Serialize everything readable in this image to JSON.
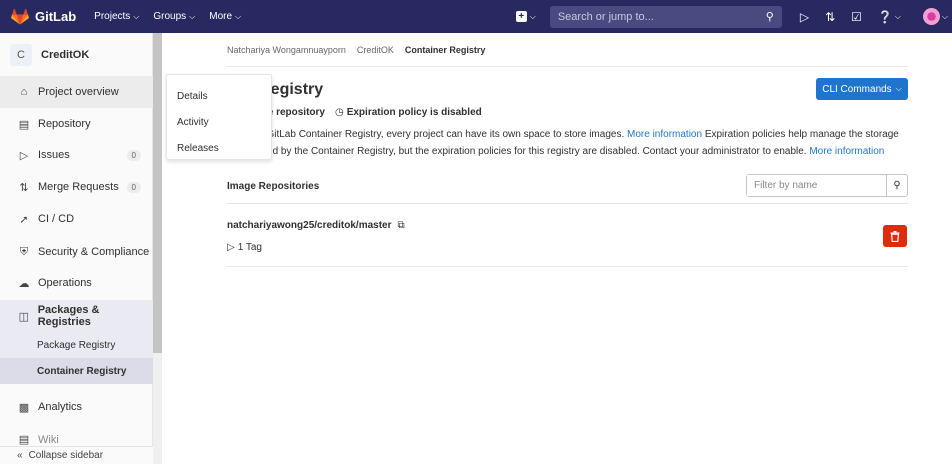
{
  "topbar": {
    "brand": "GitLab",
    "menus": [
      "Projects",
      "Groups",
      "More"
    ],
    "search_placeholder": "Search or jump to..."
  },
  "sidebar": {
    "project_initial": "C",
    "project_name": "CreditOK",
    "items": [
      {
        "label": "Project overview"
      },
      {
        "label": "Repository"
      },
      {
        "label": "Issues",
        "badge": "0"
      },
      {
        "label": "Merge Requests",
        "badge": "0"
      },
      {
        "label": "CI / CD"
      },
      {
        "label": "Security & Compliance"
      },
      {
        "label": "Operations"
      },
      {
        "label": "Packages & Registries"
      },
      {
        "label": "Analytics"
      },
      {
        "label": "Wiki"
      }
    ],
    "sub_items": [
      "Package Registry",
      "Container Registry"
    ],
    "collapse_label": "Collapse sidebar"
  },
  "flyout": {
    "items": [
      "Details",
      "Activity",
      "Releases"
    ]
  },
  "breadcrumb": [
    "Natchariya Wongamnuayporn",
    "CreditOK",
    "Container Registry"
  ],
  "main": {
    "title": "Container Registry",
    "cli_button": "CLI Commands",
    "repo_count": "1 Image repository",
    "expiration": "Expiration policy is disabled",
    "desc_1": "With the GitLab Container Registry, every project can have its own space to store images.",
    "link_more_1": "More information",
    "desc_2": "Expiration policies help manage the storage space used by the Container Registry, but the expiration policies for this registry are disabled. Contact your administrator to enable.",
    "link_more_2": "More information",
    "section_title": "Image Repositories",
    "filter_placeholder": "Filter by name",
    "repo": {
      "name": "natchariyawong25/creditok/master",
      "tags": "1 Tag"
    }
  },
  "colors": {
    "topbar": "#292961",
    "accent": "#1f75cb",
    "danger": "#dd2b0e"
  }
}
